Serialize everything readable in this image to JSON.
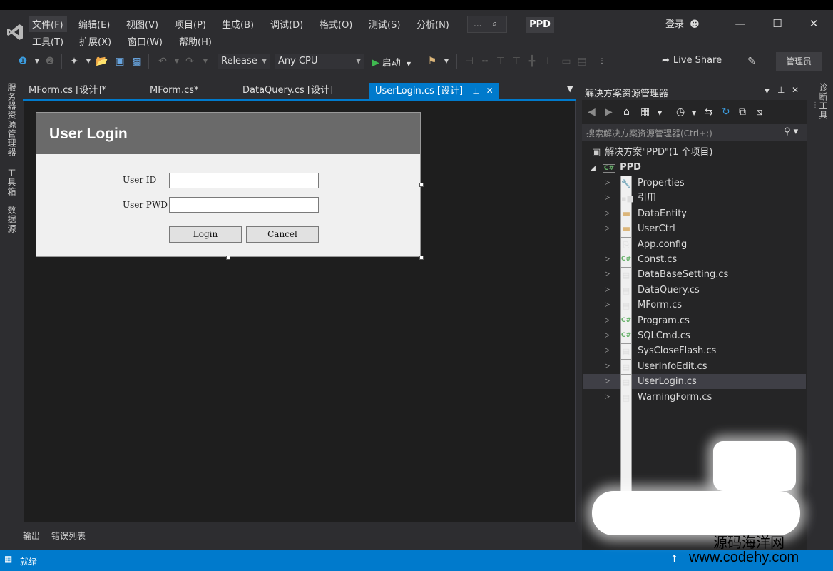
{
  "menu": {
    "row1": [
      "文件(F)",
      "编辑(E)",
      "视图(V)",
      "项目(P)",
      "生成(B)",
      "调试(D)",
      "格式(O)",
      "测试(S)",
      "分析(N)"
    ],
    "row2": [
      "工具(T)",
      "扩展(X)",
      "窗口(W)",
      "帮助(H)"
    ]
  },
  "titlebar": {
    "search_dots": "...",
    "project_badge": "PPD",
    "sign_in": "登录"
  },
  "toolbar": {
    "configuration": "Release",
    "platform": "Any CPU",
    "start_label": "启动",
    "live_share": "Live Share",
    "admin_badge": "管理员"
  },
  "left_strip": [
    "服务器资源管理器",
    "工具箱",
    "数据源"
  ],
  "right_strip": [
    "诊断工具"
  ],
  "tabs": [
    {
      "label": "MForm.cs [设计]*",
      "active": false
    },
    {
      "label": "MForm.cs*",
      "active": false
    },
    {
      "label": "DataQuery.cs [设计]",
      "active": false
    },
    {
      "label": "UserLogin.cs [设计]",
      "active": true
    }
  ],
  "designer": {
    "form_title": "User Login",
    "user_id_label": "User ID",
    "user_pwd_label": "User PWD",
    "login_button": "Login",
    "cancel_button": "Cancel"
  },
  "solution_explorer": {
    "title": "解决方案资源管理器",
    "search_placeholder": "搜索解决方案资源管理器(Ctrl+;)",
    "solution_label": "解决方案\"PPD\"(1 个项目)",
    "project_label": "PPD",
    "items": [
      {
        "label": "Properties",
        "icon": "wrench-icon"
      },
      {
        "label": "引用",
        "icon": "references-icon"
      },
      {
        "label": "DataEntity",
        "icon": "folder-icon"
      },
      {
        "label": "UserCtrl",
        "icon": "folder-icon"
      },
      {
        "label": "App.config",
        "icon": "config-file-icon"
      },
      {
        "label": "Const.cs",
        "icon": "csharp-file-icon"
      },
      {
        "label": "DataBaseSetting.cs",
        "icon": "form-file-icon"
      },
      {
        "label": "DataQuery.cs",
        "icon": "form-file-icon"
      },
      {
        "label": "MForm.cs",
        "icon": "form-file-icon"
      },
      {
        "label": "Program.cs",
        "icon": "csharp-file-icon"
      },
      {
        "label": "SQLCmd.cs",
        "icon": "csharp-file-icon"
      },
      {
        "label": "SysCloseFlash.cs",
        "icon": "form-file-icon"
      },
      {
        "label": "UserInfoEdit.cs",
        "icon": "form-file-icon"
      },
      {
        "label": "UserLogin.cs",
        "icon": "form-file-icon"
      },
      {
        "label": "WarningForm.cs",
        "icon": "form-file-icon"
      }
    ]
  },
  "bottom_tabs": [
    "输出",
    "错误列表"
  ],
  "status": {
    "text": "就绪"
  },
  "watermark": {
    "line1": "源码海洋网",
    "line2": "www.codehy.com"
  },
  "colors": {
    "accent": "#007acc",
    "background": "#2d2d30",
    "editor": "#1e1e1e",
    "form_title_bar": "#6a6a6a"
  }
}
